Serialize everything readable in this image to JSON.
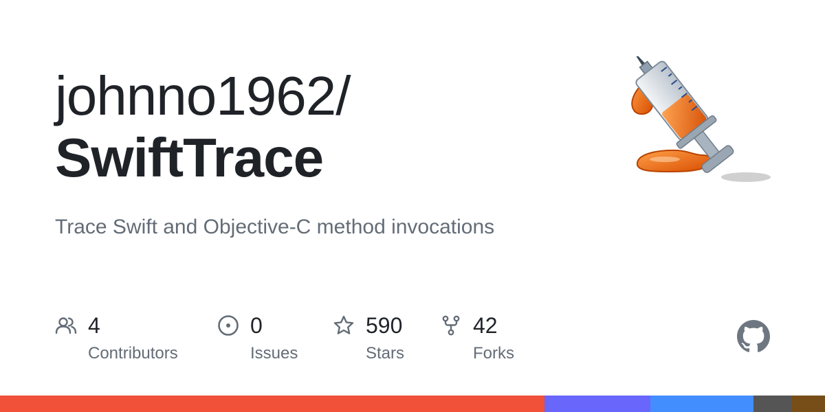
{
  "repo": {
    "owner": "johnno1962/",
    "name": "SwiftTrace",
    "description": "Trace Swift and Objective-C method invocations"
  },
  "stats": [
    {
      "icon": "people-icon",
      "value": "4",
      "label": "Contributors"
    },
    {
      "icon": "issue-opened-icon",
      "value": "0",
      "label": "Issues"
    },
    {
      "icon": "star-icon",
      "value": "590",
      "label": "Stars"
    },
    {
      "icon": "repo-forked-icon",
      "value": "42",
      "label": "Forks"
    }
  ],
  "icons": {
    "logo": "syringe-logo",
    "github": "github-mark-icon"
  },
  "colors": {
    "text": "#1f2328",
    "muted": "#636c76",
    "icon": "#636c76",
    "github_icon": "#6e7781"
  },
  "language_bar": [
    {
      "color": "#f05138",
      "percent": 66
    },
    {
      "color": "#6866fb",
      "percent": 12.8
    },
    {
      "color": "#438eff",
      "percent": 12.5
    },
    {
      "color": "#555555",
      "percent": 4.6
    },
    {
      "color": "#774e17",
      "percent": 4.1
    }
  ]
}
